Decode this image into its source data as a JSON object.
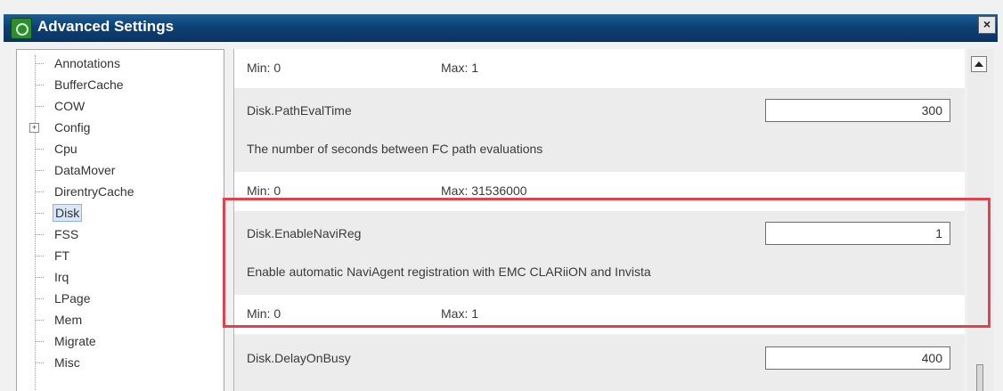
{
  "window": {
    "title": "Advanced Settings",
    "close_label": "×"
  },
  "tree": {
    "expander_symbol": "+",
    "items": [
      {
        "label": "Annotations"
      },
      {
        "label": "BufferCache"
      },
      {
        "label": "COW"
      },
      {
        "label": "Config"
      },
      {
        "label": "Cpu"
      },
      {
        "label": "DataMover"
      },
      {
        "label": "DirentryCache"
      },
      {
        "label": "Disk"
      },
      {
        "label": "FSS"
      },
      {
        "label": "FT"
      },
      {
        "label": "Irq"
      },
      {
        "label": "LPage"
      },
      {
        "label": "Mem"
      },
      {
        "label": "Migrate"
      },
      {
        "label": "Misc"
      }
    ],
    "selected": "Disk"
  },
  "content": {
    "top_row": {
      "min": "Min:  0",
      "max": "Max:  1"
    },
    "settings": [
      {
        "name": "Disk.PathEvalTime",
        "value": "300",
        "description": "The number of seconds between FC path evaluations",
        "min": "Min:  0",
        "max": "Max:  31536000"
      },
      {
        "name": "Disk.EnableNaviReg",
        "value": "1",
        "description": "Enable automatic NaviAgent registration with EMC CLARiiON and Invista",
        "min": "Min:  0",
        "max": "Max:  1"
      },
      {
        "name": "Disk.DelayOnBusy",
        "value": "400"
      }
    ]
  },
  "colors": {
    "titlebar": "#0c3f73",
    "highlight": "#e0424f",
    "selected": "#d9e6f7"
  },
  "icons": [
    "app-icon",
    "close-icon",
    "tree-expander-icon",
    "scroll-up-icon"
  ]
}
